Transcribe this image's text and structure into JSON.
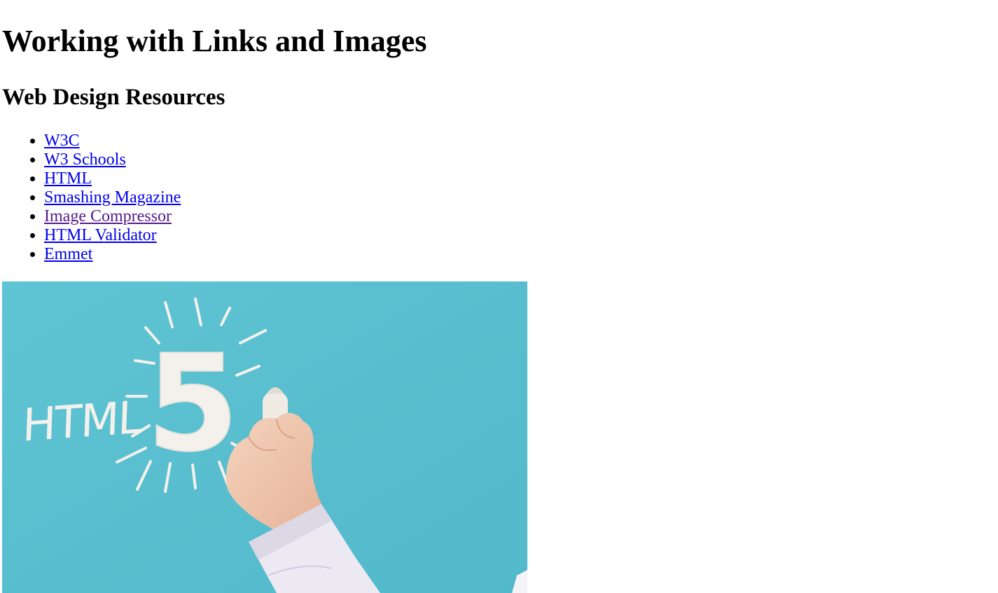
{
  "page": {
    "title": "Working with Links and Images",
    "section_heading": "Web Design Resources"
  },
  "links": [
    {
      "label": "W3C",
      "visited": false
    },
    {
      "label": "W3 Schools",
      "visited": false
    },
    {
      "label": "HTML",
      "visited": false
    },
    {
      "label": "Smashing Magazine",
      "visited": false
    },
    {
      "label": "Image Compressor",
      "visited": true
    },
    {
      "label": "HTML Validator",
      "visited": false
    },
    {
      "label": "Emmet",
      "visited": false
    }
  ],
  "image": {
    "chalk_text": "HTML",
    "chalk_number": "5",
    "background_color": "#5ec5d4",
    "chalk_color": "#f4f1ec"
  },
  "colors": {
    "link": "#0000ee",
    "visited_link": "#551a8b",
    "text": "#000000",
    "background": "#ffffff"
  }
}
